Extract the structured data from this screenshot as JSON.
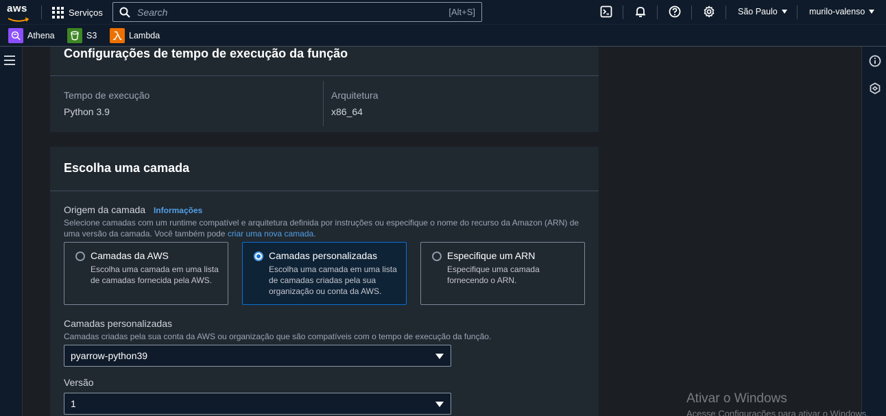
{
  "nav": {
    "logo": "aws",
    "services_label": "Serviços",
    "search_placeholder": "Search",
    "search_shortcut": "[Alt+S]",
    "region": "São Paulo",
    "account": "murilo-valenso"
  },
  "favorites": [
    {
      "label": "Athena",
      "color": "#8c4fff"
    },
    {
      "label": "S3",
      "color": "#3f8624"
    },
    {
      "label": "Lambda",
      "color": "#ed7100"
    }
  ],
  "runtime_card": {
    "title": "Configurações de tempo de execução da função",
    "runtime_label": "Tempo de execução",
    "runtime_value": "Python 3.9",
    "arch_label": "Arquitetura",
    "arch_value": "x86_64"
  },
  "layer_card": {
    "title": "Escolha uma camada",
    "origin_label": "Origem da camada",
    "info_link": "Informações",
    "origin_desc_part1": "Selecione camadas com um runtime compatível e arquitetura definida por instruções ou especifique o nome do recurso da Amazon (ARN) de uma versão da camada. Você também pode ",
    "origin_desc_link": "criar uma nova camada",
    "origin_desc_part2": ".",
    "options": [
      {
        "title": "Camadas da AWS",
        "desc": "Escolha uma camada em uma lista de camadas fornecida pela AWS.",
        "selected": false
      },
      {
        "title": "Camadas personalizadas",
        "desc": "Escolha uma camada em uma lista de camadas criadas pela sua organização ou conta da AWS.",
        "selected": true
      },
      {
        "title": "Especifique um ARN",
        "desc": "Especifique uma camada fornecendo o ARN.",
        "selected": false
      }
    ],
    "custom_label": "Camadas personalizadas",
    "custom_desc": "Camadas criadas pela sua conta da AWS ou organização que são compatíveis com o tempo de execução da função.",
    "custom_value": "pyarrow-python39",
    "version_label": "Versão",
    "version_value": "1"
  },
  "watermark": {
    "title": "Ativar o Windows",
    "subtitle": "Acesse Configurações para ativar o Windows."
  },
  "colors": {
    "accent": "#539fe5",
    "selected_border": "#0972d3",
    "nav_bg": "#0f1b2a",
    "card_bg": "#202830"
  }
}
